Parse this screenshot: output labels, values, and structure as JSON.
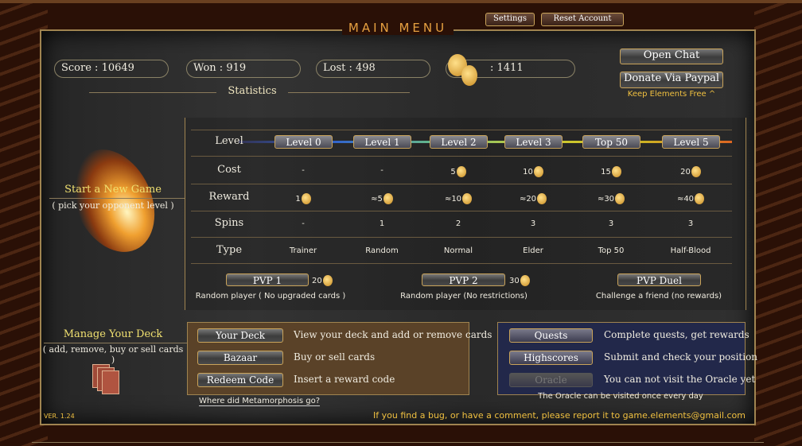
{
  "header": {
    "title": "MAIN MENU",
    "settings": "Settings",
    "reset": "Reset Account"
  },
  "stats": {
    "score": "Score : 10649",
    "won": "Won : 919",
    "lost": "Lost : 498",
    "coins": ": 1411",
    "section": "Statistics"
  },
  "side": {
    "open_chat": "Open Chat",
    "donate": "Donate Via Paypal",
    "keep_free": "Keep Elements Free ^"
  },
  "new_game": {
    "title": "Start a New Game",
    "subtitle": "( pick your opponent level )"
  },
  "table": {
    "row_labels": [
      "Level",
      "Cost",
      "Reward",
      "Spins",
      "Type"
    ],
    "levels": [
      "Level 0",
      "Level 1",
      "Level 2",
      "Level 3",
      "Top 50",
      "Level 5"
    ],
    "cost": [
      "-",
      "-",
      "5",
      "10",
      "15",
      "20"
    ],
    "reward": [
      "1",
      "≈5",
      "≈10",
      "≈20",
      "≈30",
      "≈40"
    ],
    "spins": [
      "-",
      "1",
      "2",
      "3",
      "3",
      "3"
    ],
    "type": [
      "Trainer",
      "Random",
      "Normal",
      "Elder",
      "Top 50",
      "Half-Blood"
    ]
  },
  "pvp": [
    {
      "label": "PVP  1",
      "cost": "20",
      "desc": "Random player ( No upgraded cards )"
    },
    {
      "label": "PVP  2",
      "cost": "30",
      "desc": "Random player (No restrictions)"
    },
    {
      "label": "PVP Duel",
      "desc": "Challenge a friend (no rewards)"
    }
  ],
  "deck": {
    "title": "Manage Your Deck",
    "subtitle": "( add, remove, buy or sell cards )",
    "items": [
      {
        "label": "Your Deck",
        "desc": "View your deck and add or remove cards"
      },
      {
        "label": "Bazaar",
        "desc": "Buy or sell cards"
      },
      {
        "label": "Redeem Code",
        "desc": "Insert a reward code"
      }
    ],
    "link": "Where did Metamorphosis go?"
  },
  "extras": {
    "items": [
      {
        "label": "Quests",
        "desc": "Complete quests, get rewards"
      },
      {
        "label": "Highscores",
        "desc": "Submit and check your position"
      },
      {
        "label": "Oracle",
        "desc": "You can not visit the Oracle yet",
        "disabled": true
      }
    ],
    "note": "The Oracle can be visited once every day"
  },
  "footer": {
    "version": "VER. 1.24",
    "bug": "If you find a bug, or have a comment, please report it to game.elements@gmail.com"
  },
  "colors": {
    "accent": "#e6a040",
    "gold_border": "#c9a35a",
    "deck_box": "#5a4228",
    "extras_box": "#22284a"
  }
}
